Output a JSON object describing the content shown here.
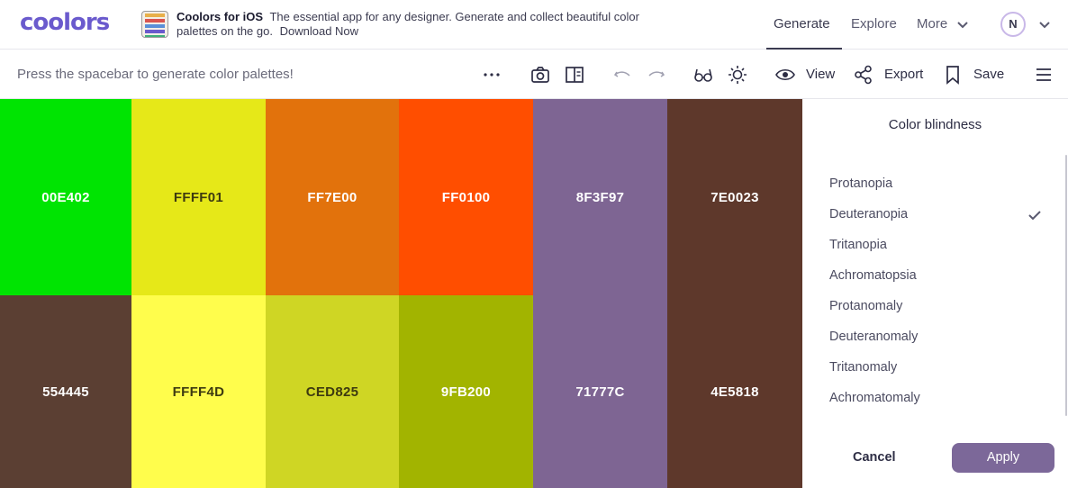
{
  "app": {
    "logo": "coolors"
  },
  "promo": {
    "title": "Coolors for iOS",
    "text": "The essential app for any designer. Generate and collect beautiful color palettes on the go.",
    "link": "Download Now"
  },
  "nav": {
    "generate": "Generate",
    "explore": "Explore",
    "more": "More",
    "avatar_initial": "N"
  },
  "toolbar": {
    "hint": "Press the spacebar to generate color palettes!",
    "view": "View",
    "export": "Export",
    "save": "Save"
  },
  "palette": {
    "top": [
      {
        "hex": "00E402",
        "bg": "#00e402",
        "fg": "#ffffff"
      },
      {
        "hex": "FFFF01",
        "bg": "#e6e818",
        "fg": "#3d3a10"
      },
      {
        "hex": "FF7E00",
        "bg": "#e2720c",
        "fg": "#ffffff"
      },
      {
        "hex": "FF0100",
        "bg": "#ff4e00",
        "fg": "#ffffff"
      },
      {
        "hex": "8F3F97",
        "bg": "#7e6593",
        "fg": "#ffffff"
      }
    ],
    "bottom": [
      {
        "hex": "554445",
        "bg": "#5b3f33",
        "fg": "#ffffff"
      },
      {
        "hex": "FFFF4D",
        "bg": "#fffd4c",
        "fg": "#3d3a10"
      },
      {
        "hex": "CED825",
        "bg": "#cfd624",
        "fg": "#3d3a10"
      },
      {
        "hex": "9FB200",
        "bg": "#a2b400",
        "fg": "#ffffff"
      },
      {
        "hex": "71777C",
        "bg": "#7e6593",
        "fg": "#ffffff"
      }
    ],
    "tall": [
      {
        "hex": "7E0023",
        "bg": "#5e382b",
        "fg": "#ffffff"
      },
      {
        "hex": "4E5818",
        "bg": "#5e382b",
        "fg": "#ffffff"
      }
    ]
  },
  "color_blindness": {
    "title": "Color blindness",
    "options": [
      "Protanopia",
      "Deuteranopia",
      "Tritanopia",
      "Achromatopsia",
      "Protanomaly",
      "Deuteranomaly",
      "Tritanomaly",
      "Achromatomaly"
    ],
    "selected": "Deuteranopia",
    "cancel": "Cancel",
    "apply": "Apply"
  },
  "colors": {
    "brand": "#6a5acd",
    "apply_button": "#7c6899"
  },
  "icons": [
    "dots-icon",
    "camera-icon",
    "book-icon",
    "undo-icon",
    "redo-icon",
    "glasses-icon",
    "sun-icon",
    "eye-icon",
    "share-icon",
    "bookmark-icon",
    "hamburger-icon",
    "chevron-down-icon",
    "check-icon"
  ]
}
